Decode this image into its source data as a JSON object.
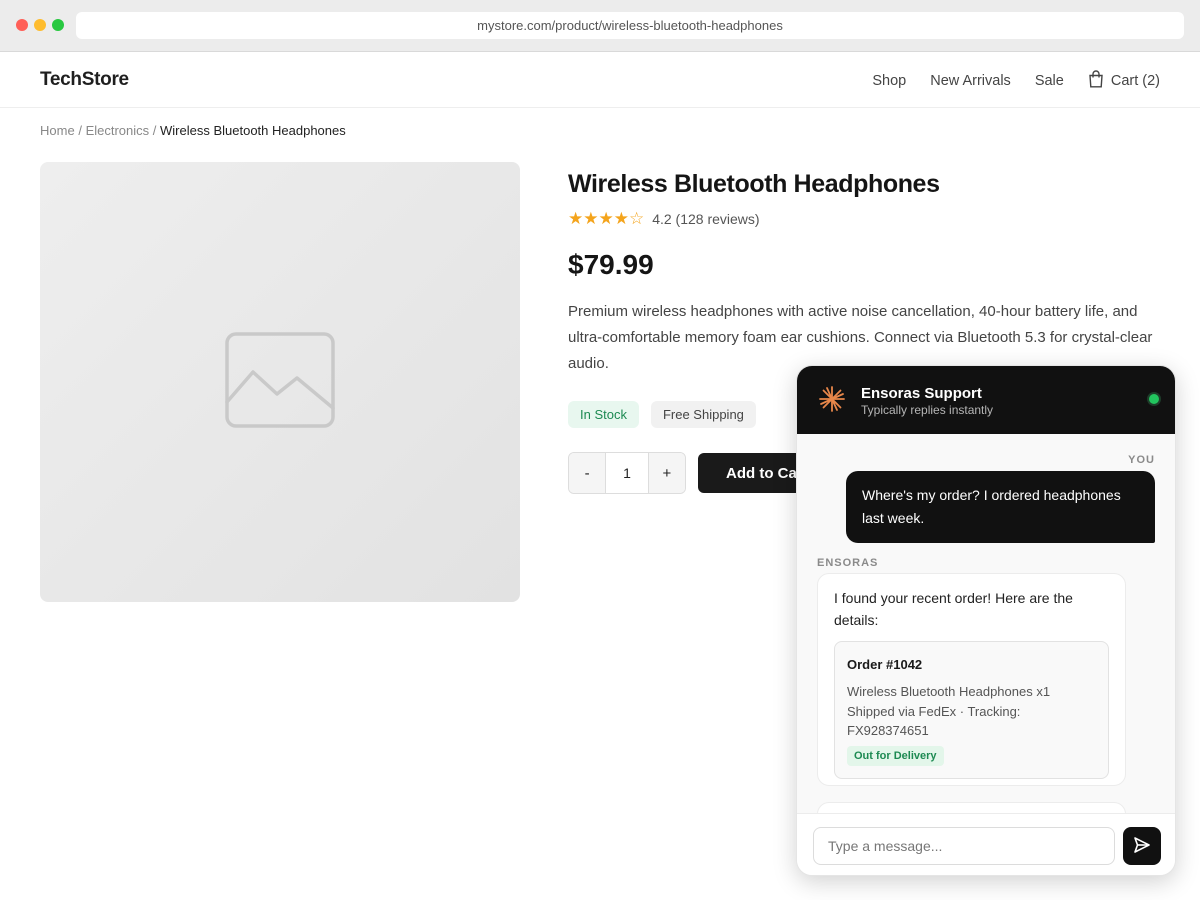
{
  "browser": {
    "url": "mystore.com/product/wireless-bluetooth-headphones"
  },
  "header": {
    "logo": "TechStore",
    "nav": [
      "Shop",
      "New Arrivals",
      "Sale"
    ],
    "cart_label": "Cart (2)"
  },
  "breadcrumb": {
    "home": "Home",
    "category": "Electronics",
    "current": "Wireless Bluetooth Headphones",
    "separator": "/"
  },
  "product": {
    "title": "Wireless Bluetooth Headphones",
    "stars": "★★★★☆",
    "rating_value": 4.2,
    "rating_text": "4.2 (128 reviews)",
    "price": "$79.99",
    "description": "Premium wireless headphones with active noise cancellation, 40-hour battery life, and ultra-comfortable memory foam ear cushions. Connect via Bluetooth 5.3 for crystal-clear audio.",
    "badges": [
      "In Stock",
      "Free Shipping"
    ],
    "quantity": "1",
    "qty_minus": "-",
    "qty_plus": "+",
    "add_to_cart": "Add to Cart"
  },
  "chat": {
    "title": "Ensoras Support",
    "subtitle": "Typically replies instantly",
    "user_label": "YOU",
    "bot_label": "ENSORAS",
    "user_message": "Where's my order? I ordered headphones last week.",
    "bot_message": "I found your recent order! Here are the details:",
    "order": {
      "id": "Order #1042",
      "item": "Wireless Bluetooth Headphones x1",
      "shipping": "Shipped via FedEx · Tracking: FX928374651",
      "status": "Out for Delivery"
    },
    "input_placeholder": "Type a message...",
    "colors": {
      "accent": "#111111",
      "online": "#22c55e",
      "logo": "#e8874a"
    }
  }
}
